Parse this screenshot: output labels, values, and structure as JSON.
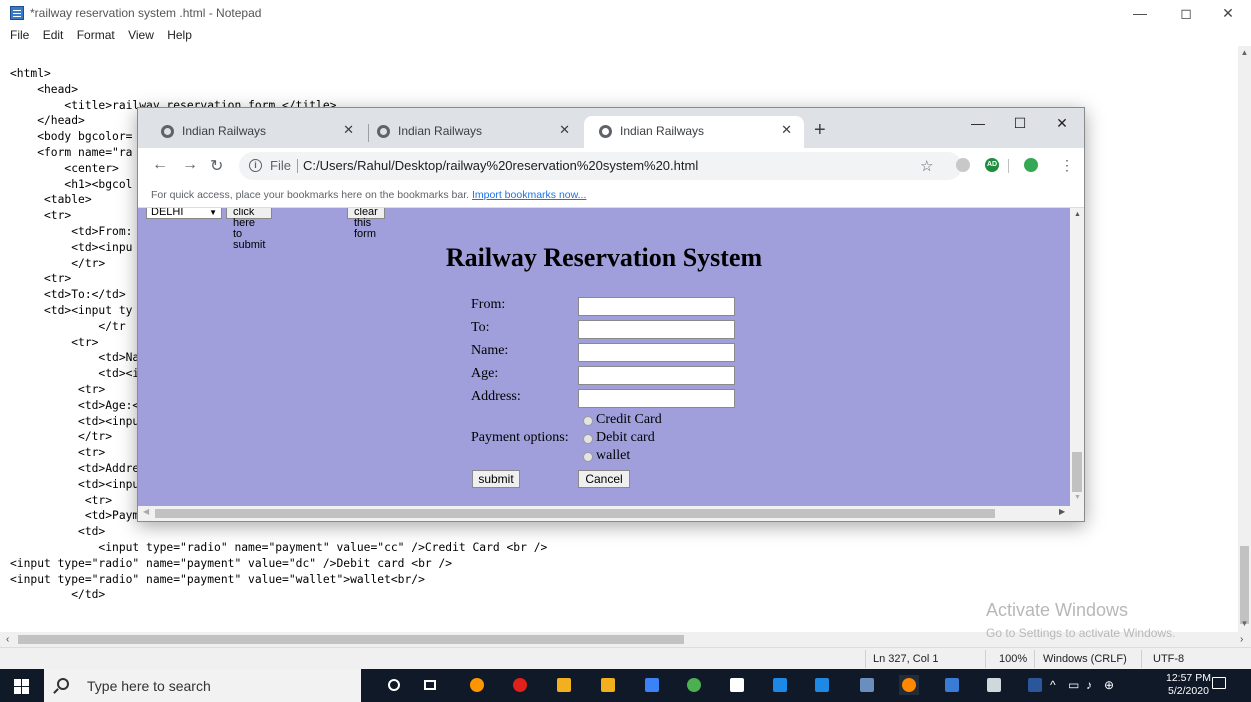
{
  "notepad": {
    "title": "*railway reservation system .html - Notepad",
    "menu": [
      "File",
      "Edit",
      "Format",
      "View",
      "Help"
    ],
    "controls": {
      "minimize": "—",
      "maximize": "◻",
      "close": "✕"
    },
    "code_lines": [
      "<html>",
      "    <head>",
      "        <title>railway reservation form </title>",
      "    </head>",
      "    <body bgcolor=",
      "    <form name=\"ra",
      "        <center>",
      "        <h1><bgcol",
      "     <table>",
      "     <tr>",
      "         <td>From:",
      "         <td><inpu",
      "         </tr>",
      "     <tr>",
      "     <td>To:</td>",
      "     <td><input ty",
      "             </tr",
      "         <tr>",
      "             <td>Na",
      "             <td><i",
      "          <tr>",
      "          <td>Age:<",
      "          <td><inpu",
      "          </tr>",
      "          <tr>",
      "          <td>Addre",
      "          <td><inpu",
      "           <tr>",
      "           <td>Payment options:</td>",
      "          <td>",
      "             <input type=\"radio\" name=\"payment\" value=\"cc\" />Credit Card <br />",
      "<input type=\"radio\" name=\"payment\" value=\"dc\" />Debit card <br />",
      "<input type=\"radio\" name=\"payment\" value=\"wallet\">wallet<br/>",
      "         </td>"
    ],
    "status": {
      "position": "Ln 327, Col 1",
      "zoom": "100%",
      "line_endings": "Windows (CRLF)",
      "encoding": "UTF-8"
    }
  },
  "watermark": {
    "line1": "Activate Windows",
    "line2": "Go to Settings to activate Windows."
  },
  "chrome": {
    "tabs": [
      {
        "label": "Indian Railways",
        "close": "✕",
        "active": false
      },
      {
        "label": "Indian Railways",
        "close": "✕",
        "active": false
      },
      {
        "label": "Indian Railways",
        "close": "✕",
        "active": true
      }
    ],
    "new_tab": "+",
    "controls": {
      "minimize": "—",
      "maximize": "☐",
      "close": "✕"
    },
    "address": {
      "scheme": "File",
      "url": "C:/Users/Rahul/Desktop/railway%20reservation%20system%20.html"
    },
    "bookmarks_hint": "For quick access, place your bookmarks here on the bookmarks bar.",
    "bookmarks_link": "Import bookmarks now...",
    "extension_badge": "AD"
  },
  "page": {
    "select_value": "DELHI",
    "submit_top": "click here to submit",
    "clear_top": "clear this form",
    "heading": "Railway Reservation System",
    "fields": [
      {
        "label": "From:",
        "value": ""
      },
      {
        "label": "To:",
        "value": ""
      },
      {
        "label": "Name:",
        "value": ""
      },
      {
        "label": "Age:",
        "value": ""
      },
      {
        "label": "Address:",
        "value": ""
      }
    ],
    "payment_label": "Payment options:",
    "payment_options": [
      "Credit Card",
      "Debit card",
      "wallet"
    ],
    "submit": "submit",
    "cancel": "Cancel",
    "background_color": "#a09fdc"
  },
  "taskbar": {
    "search_placeholder": "Type here to search",
    "clock_time": "12:57 PM",
    "clock_date": "5/2/2020",
    "apps": [
      "cortana-icon",
      "task-view-icon",
      "firefox-icon",
      "opera-icon",
      "file-explorer-icon",
      "store-icon",
      "app-icon",
      "chrome-icon",
      "notepad-icon",
      "mail-icon",
      "edge-icon",
      "photos-icon",
      "vlc-icon",
      "app-icon",
      "photo-viewer-icon",
      "word-icon"
    ]
  }
}
